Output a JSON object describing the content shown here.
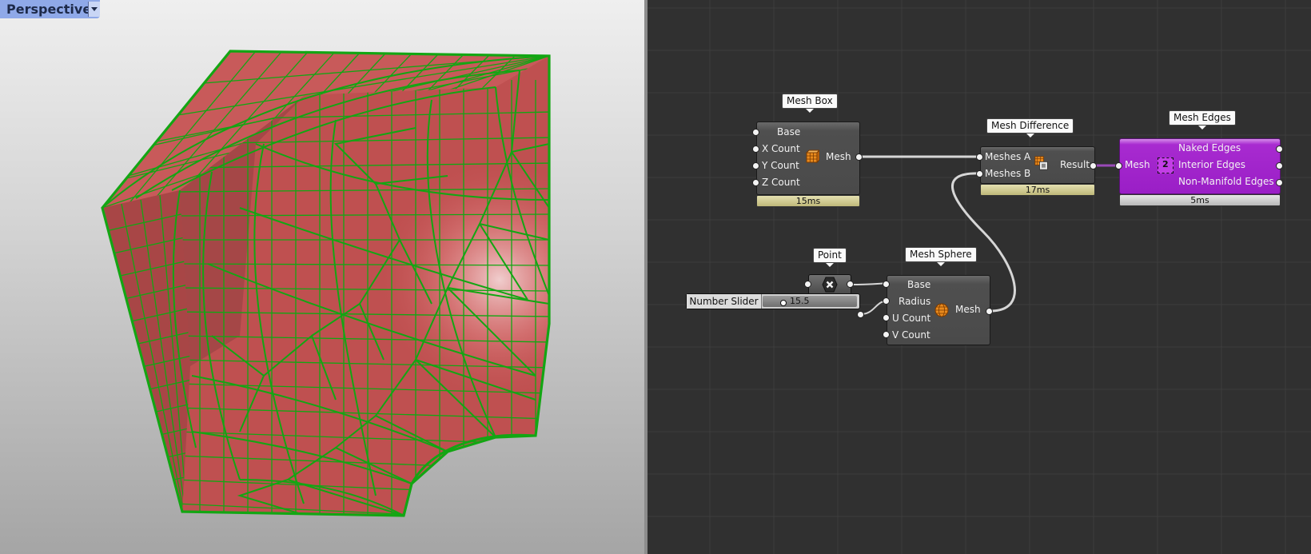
{
  "viewport": {
    "label": "Perspective"
  },
  "canvas": {
    "mesh_box": {
      "title": "Mesh Box",
      "inputs": [
        "Base",
        "X Count",
        "Y Count",
        "Z Count"
      ],
      "output": "Mesh",
      "timing": "15ms"
    },
    "mesh_difference": {
      "title": "Mesh Difference",
      "inputs": [
        "Meshes A",
        "Meshes B"
      ],
      "output": "Result",
      "timing": "17ms"
    },
    "mesh_edges": {
      "title": "Mesh Edges",
      "input": "Mesh",
      "icon_text": "2",
      "outputs": [
        "Naked Edges",
        "Interior Edges",
        "Non-Manifold Edges"
      ],
      "timing": "5ms"
    },
    "point": {
      "title": "Point"
    },
    "mesh_sphere": {
      "title": "Mesh Sphere",
      "inputs": [
        "Base",
        "Radius",
        "U Count",
        "V Count"
      ],
      "output": "Mesh"
    },
    "number_slider": {
      "label": "Number Slider",
      "value": "15.5"
    }
  },
  "colors": {
    "mesh_fill": "#c65454",
    "wireframe": "#13a613",
    "edges_component": "#9a1ec6",
    "canvas_bg": "#303030"
  }
}
